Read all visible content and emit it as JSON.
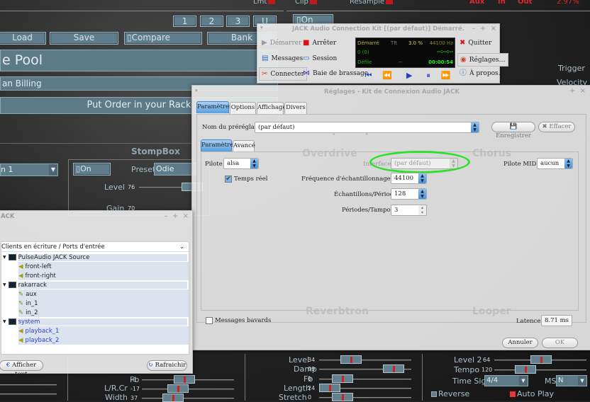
{
  "rack": {
    "indicators": {
      "lmt": "Lmt",
      "clip": "Clip",
      "resample": "Resample",
      "aux": "Aux",
      "in": "In",
      "out": "Out",
      "cpu": "2.97%"
    },
    "bank_buttons": [
      "1",
      "2",
      "3",
      "U"
    ],
    "on_right": "On",
    "load": "Load",
    "save": "Save",
    "compare": "Compare",
    "bank": "Bank",
    "preset_name": "e Pool",
    "author": "an Billing",
    "order": "Put Order in your Rack",
    "trigger": "Trigger",
    "velocity": "Velocity",
    "stompbox": {
      "title": "StompBox",
      "on": "On",
      "preset_label": "Preset",
      "preset": "Odie",
      "level_label": "Level",
      "level": "76",
      "gain_label": "Gain",
      "gain": "70"
    },
    "left_select": "n 1",
    "left_sliders": [
      {
        "label": "Fb",
        "value": "-6"
      },
      {
        "label": "L/R.Cr",
        "value": "-17"
      },
      {
        "label": "Width",
        "value": "37"
      }
    ],
    "reverb_sliders": [
      {
        "label": "Level",
        "value": "34"
      },
      {
        "label": "Damp",
        "value": "99"
      },
      {
        "label": "Fb",
        "value": "0"
      },
      {
        "label": "Length",
        "value": "24"
      },
      {
        "label": "Stretch",
        "value": "0"
      }
    ],
    "looper": {
      "level2_label": "Level 2",
      "level2": "64",
      "tempo_label": "Tempo",
      "tempo": "120",
      "timesig_label": "Time Sig.",
      "timesig": "4/4",
      "ms_label": "MS",
      "ms": "N",
      "reverse": "Reverse",
      "autoplay": "Auto Play"
    },
    "ghost": {
      "overdrive": "Overdrive",
      "chorus": "Chorus",
      "reverbtron": "Reverbtron",
      "looper": "Looper",
      "taptempo": "Tap Tempo"
    },
    "colors": {
      "accent": "#5f7d8c",
      "led": "#c0181c"
    }
  },
  "jack_main": {
    "title": "JACK Audio Connection Kit [(par défaut)] Démarré.",
    "start": "Démarrer",
    "stop": "Arrêter",
    "messages": "Messages",
    "session": "Session",
    "connect": "Connecter",
    "patchbay": "Baie de brassage",
    "quit": "Quitter",
    "setup": "Réglages…",
    "about": "À propos…",
    "display": {
      "status": "Démarré",
      "tr": "TR",
      "dsp": "3.0 %",
      "rate": "44100 Hz",
      "xruns": "0 (0)",
      "transport_pos": "--:--:--",
      "rolling": "Défile",
      "dash": "--",
      "time": "00:00:54"
    }
  },
  "setup": {
    "title": "Réglages - Kit de Connexion Audio JACK",
    "tabs": [
      "Paramètres",
      "Options",
      "Affichage",
      "Divers"
    ],
    "preset_label": "Nom du préréglage :",
    "preset_value": "(par défaut)",
    "save": "Enregistrer",
    "delete": "Effacer",
    "subtabs": [
      "Paramètres",
      "Avancé"
    ],
    "driver_label": "Pilote :",
    "driver": "alsa",
    "interface_label": "Interface :",
    "interface": "(par défaut)",
    "midi_label": "Pilote MIDI :",
    "midi": "aucun",
    "realtime": "Temps réel",
    "realtime_checked": true,
    "rate_label": "Fréquence d'échantillonnage (Hz) :",
    "rate": "44100",
    "frames_label": "Échantillons/Période :",
    "frames": "128",
    "periods_label": "Périodes/Tampon :",
    "periods": "3",
    "verbose": "Messages bavards",
    "verbose_checked": false,
    "latency_label": "Latence :",
    "latency": "8.71 ms",
    "cancel": "Annuler",
    "ok": "OK"
  },
  "connections": {
    "title": "ACK",
    "header": "Clients en écriture / Ports d'entrée",
    "tree": [
      {
        "name": "PulseAudio JACK Source",
        "ports": [
          "front-left",
          "front-right"
        ]
      },
      {
        "name": "rakarrack",
        "ports": [
          "aux",
          "in_1",
          "in_2"
        ]
      },
      {
        "name": "system",
        "ports": [
          "playback_1",
          "playback_2"
        ]
      }
    ],
    "show_all": "Afficher tout",
    "refresh": "Rafraichir"
  }
}
